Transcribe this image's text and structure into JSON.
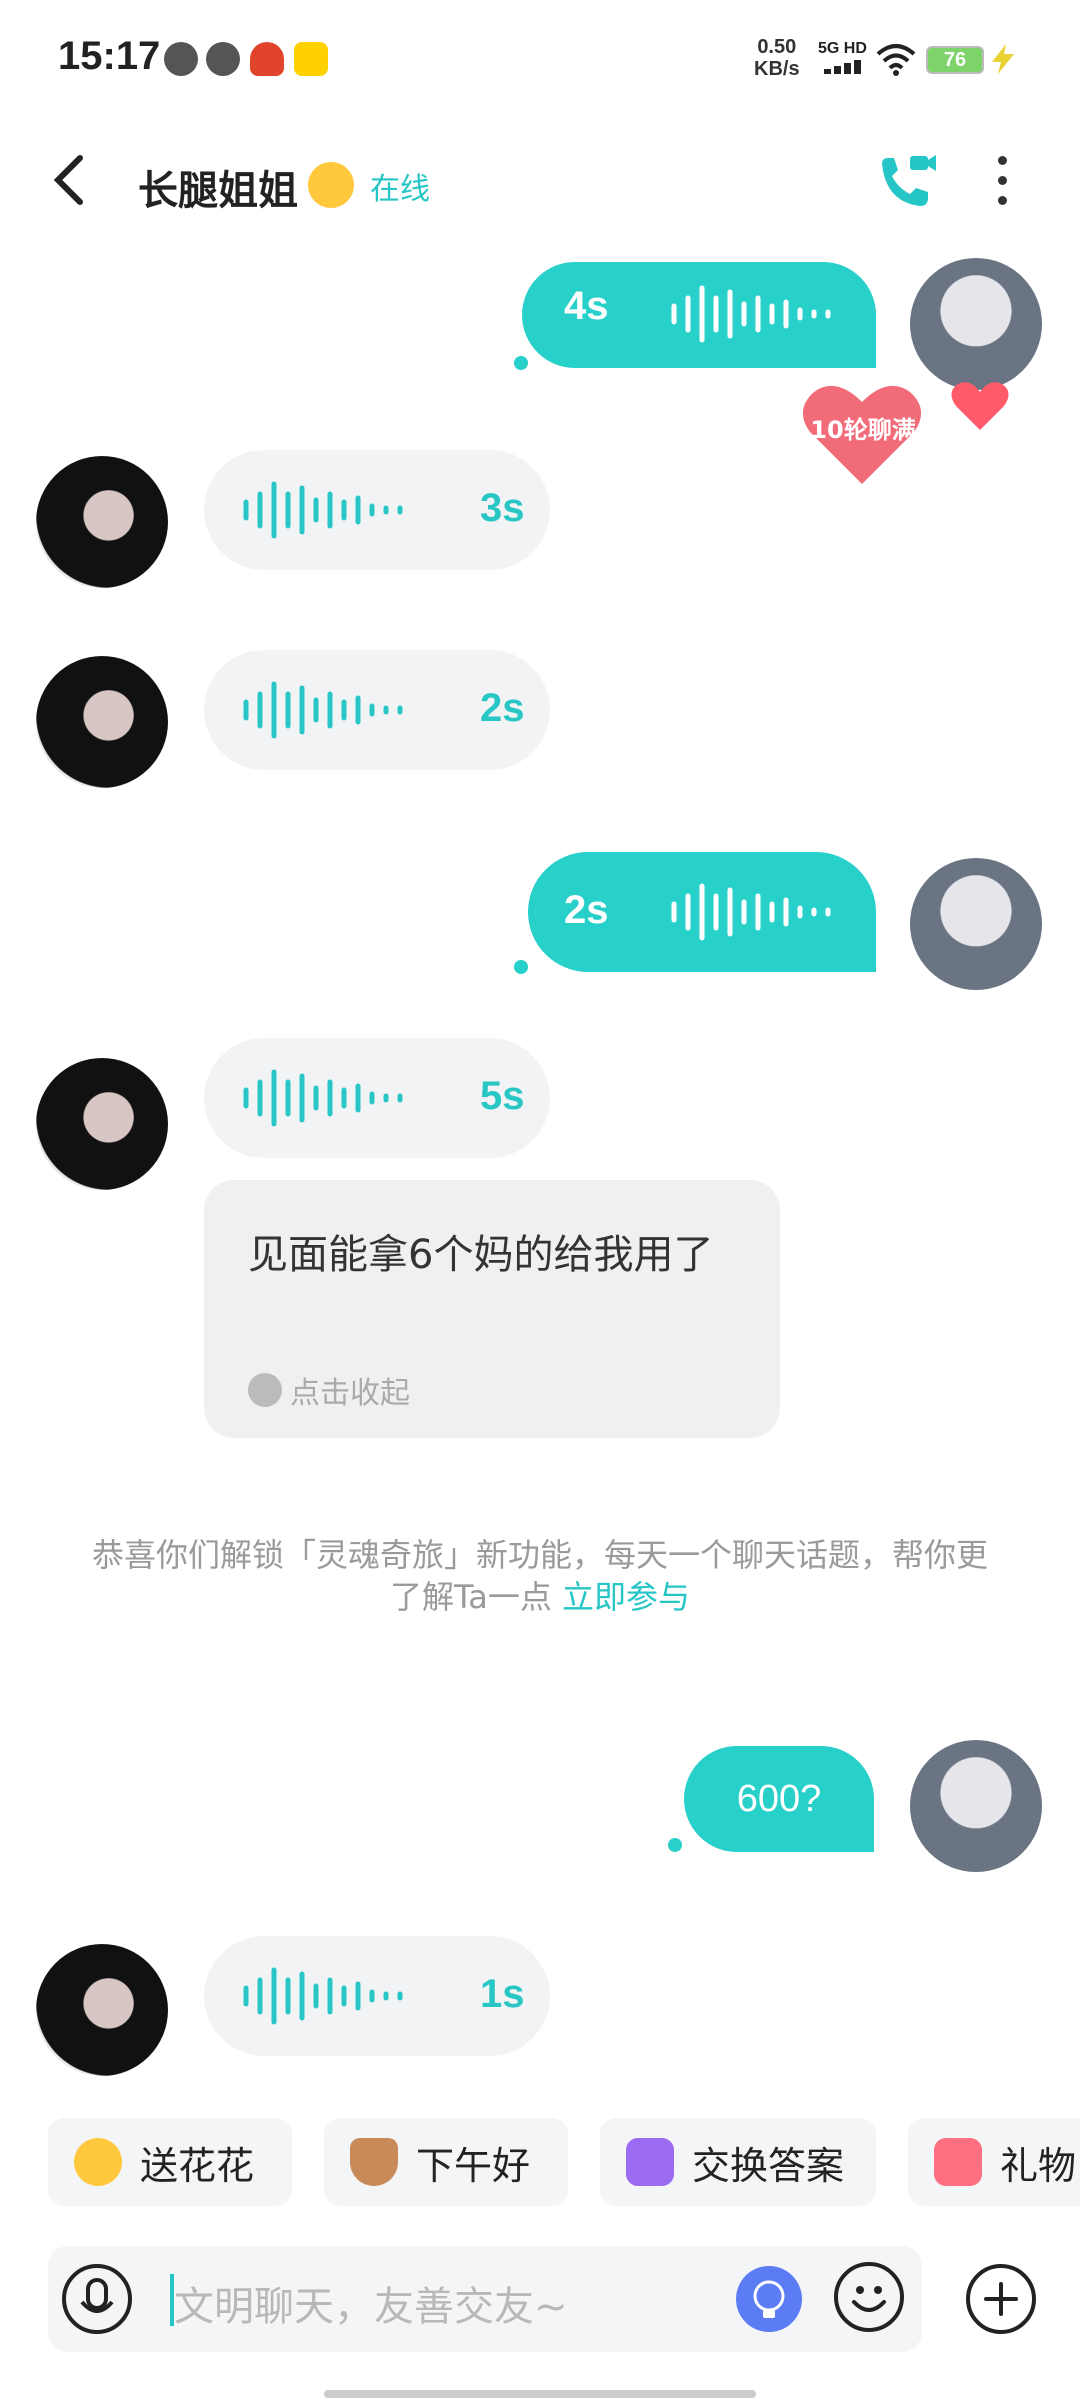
{
  "status": {
    "time": "15:17",
    "net_speed": "0.50",
    "net_unit": "KB/s",
    "signal_label": "5G HD",
    "battery": "76"
  },
  "header": {
    "name": "长腿姐姐",
    "status": "在线"
  },
  "messages": {
    "m1_duration": "4s",
    "m2_duration": "3s",
    "m3_duration": "2s",
    "m4_duration": "2s",
    "m5_duration": "5s",
    "m5_transcript": "见面能拿6个妈的给我用了",
    "collapse_label": "点击收起",
    "system_notice": "恭喜你们解锁「灵魂奇旅」新功能，每天一个聊天话题，帮你更了解Ta一点",
    "system_link": "立即参与",
    "m6_text": "600?",
    "m7_duration": "1s",
    "heart_badge": "10轮聊满"
  },
  "chips": [
    {
      "label": "送花花",
      "icon": "flower-emoji-icon"
    },
    {
      "label": "下午好",
      "icon": "coffee-icon"
    },
    {
      "label": "交换答案",
      "icon": "exchange-icon"
    },
    {
      "label": "礼物",
      "icon": "gift-icon"
    }
  ],
  "input": {
    "placeholder": "文明聊天，友善交友~"
  },
  "colors": {
    "accent": "#28d0ca",
    "incoming_bubble": "#f2f3f5"
  }
}
